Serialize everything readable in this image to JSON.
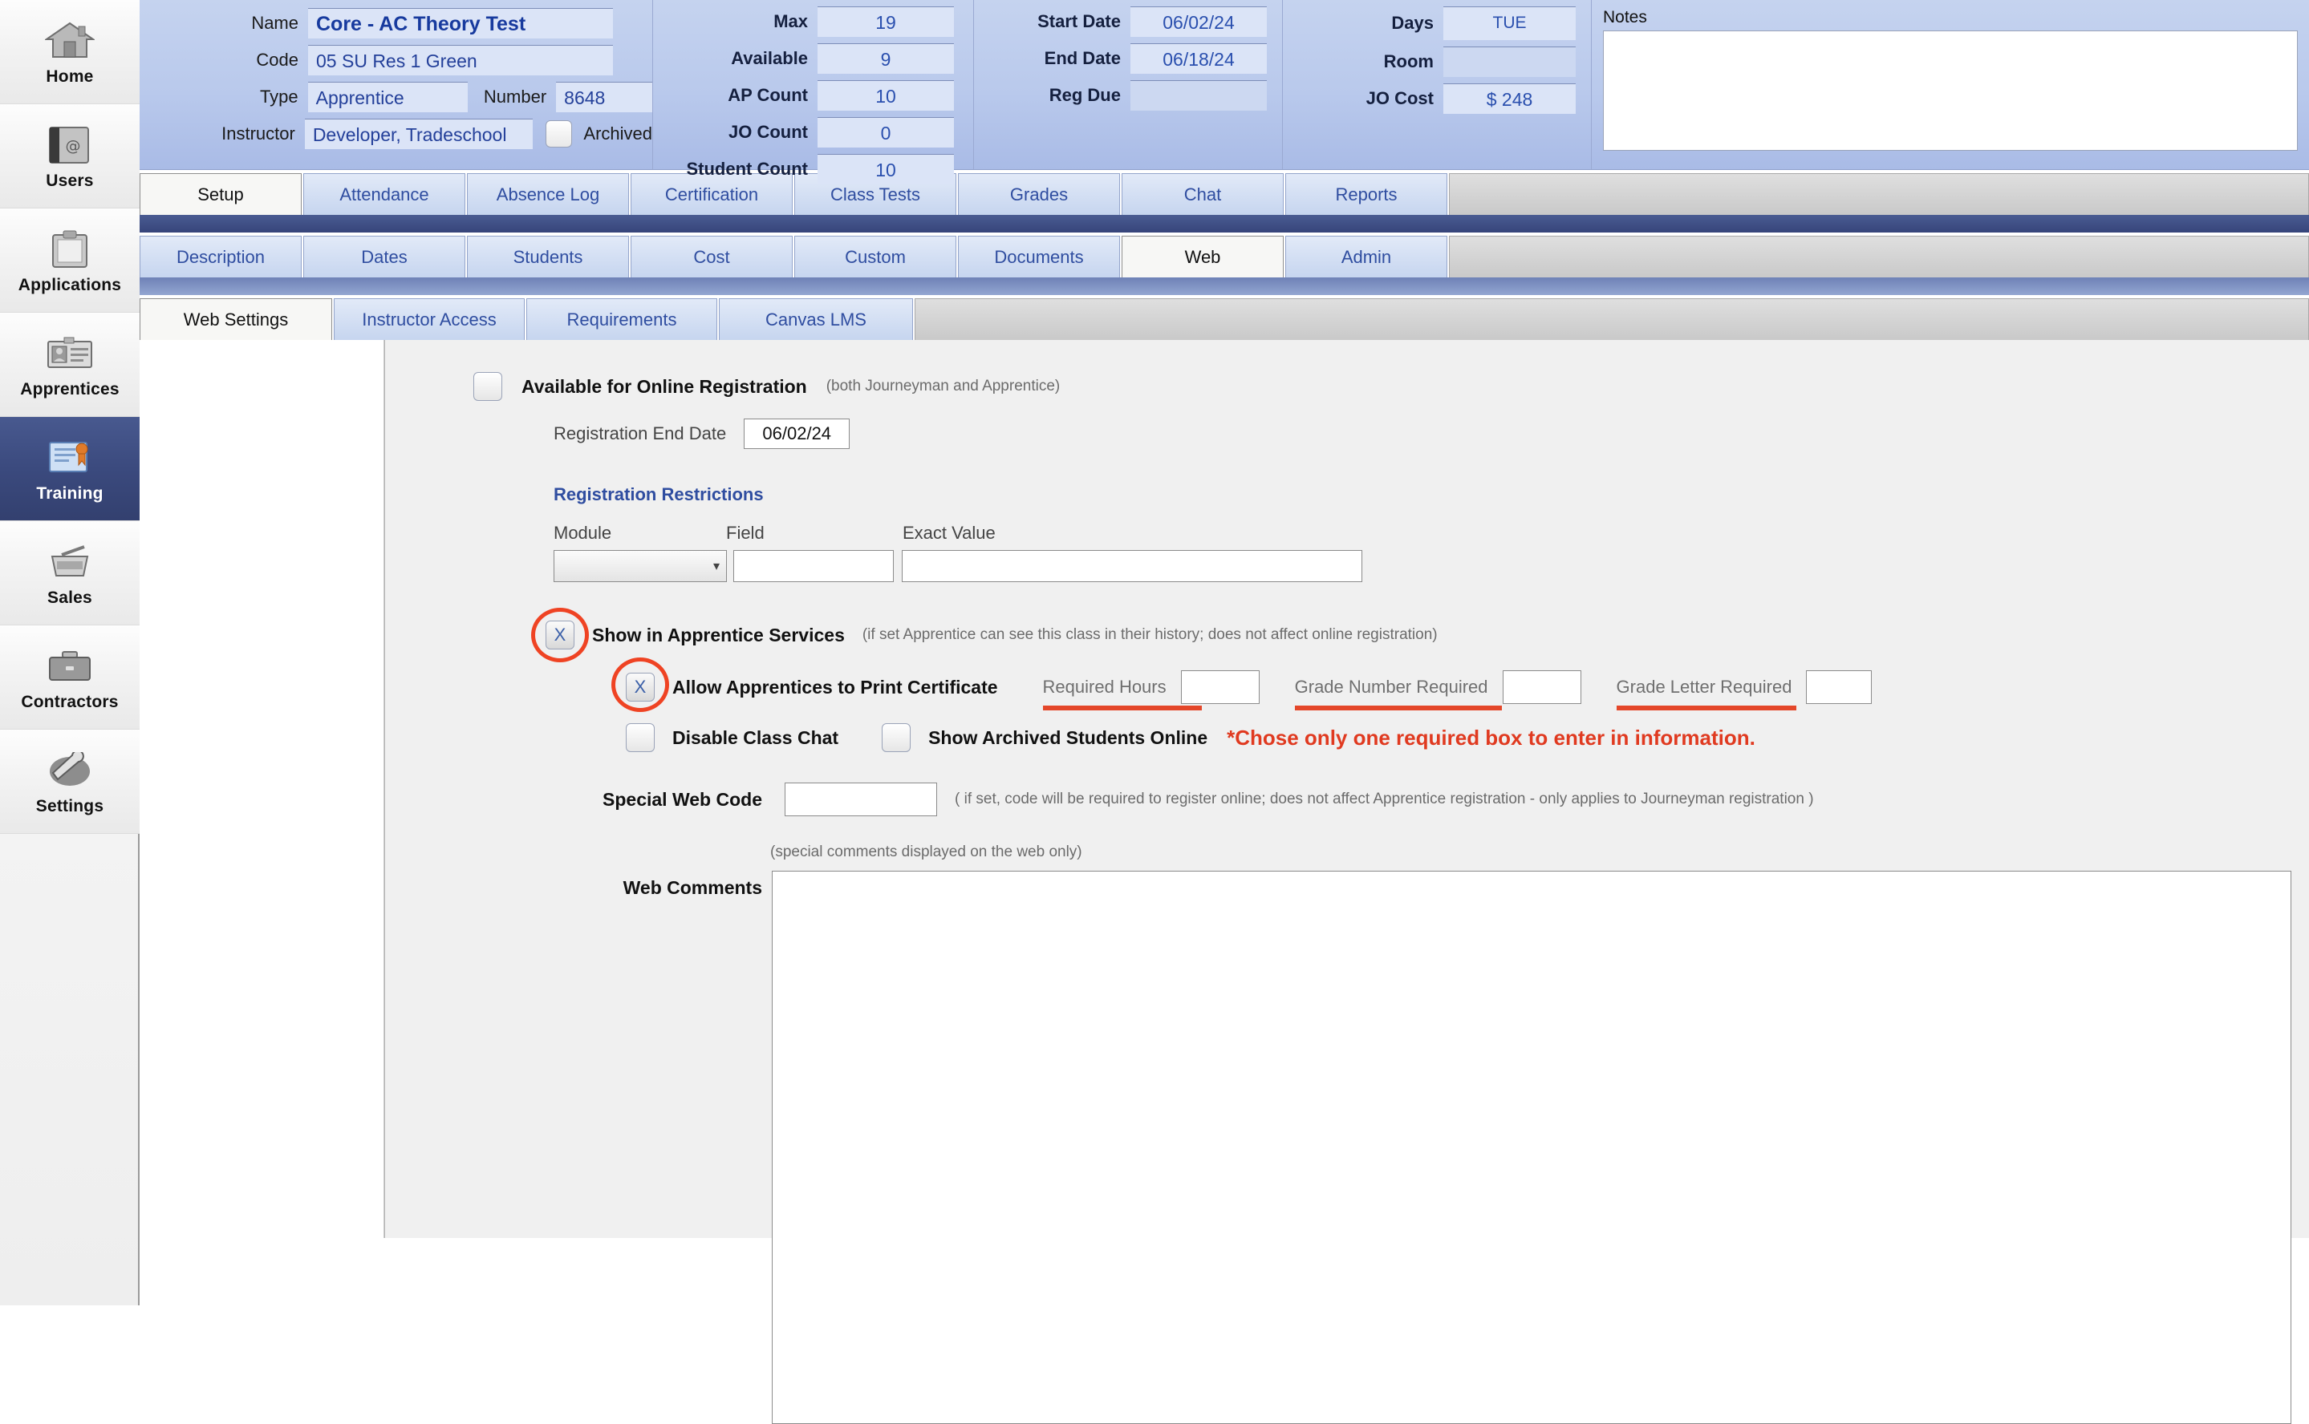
{
  "sidebar": {
    "items": [
      {
        "label": "Home",
        "icon": "house-icon",
        "active": false
      },
      {
        "label": "Users",
        "icon": "address-book-icon",
        "active": false
      },
      {
        "label": "Applications",
        "icon": "clipboard-icon",
        "active": false
      },
      {
        "label": "Apprentices",
        "icon": "id-card-icon",
        "active": false
      },
      {
        "label": "Training",
        "icon": "certificate-icon",
        "active": true
      },
      {
        "label": "Sales",
        "icon": "basket-icon",
        "active": false
      },
      {
        "label": "Contractors",
        "icon": "briefcase-icon",
        "active": false
      },
      {
        "label": "Settings",
        "icon": "wrench-icon",
        "active": false
      }
    ]
  },
  "header": {
    "name_label": "Name",
    "name_value": "Core - AC Theory Test",
    "code_label": "Code",
    "code_value": "05 SU Res 1  Green",
    "type_label": "Type",
    "type_value": "Apprentice",
    "number_label": "Number",
    "number_value": "8648",
    "instructor_label": "Instructor",
    "instructor_value": "Developer, Tradeschool",
    "archived_label": "Archived",
    "archived_checked": false,
    "counts": [
      {
        "label": "Max",
        "value": "19"
      },
      {
        "label": "Available",
        "value": "9"
      },
      {
        "label": "AP Count",
        "value": "10"
      },
      {
        "label": "JO Count",
        "value": "0"
      },
      {
        "label": "Student Count",
        "value": "10"
      }
    ],
    "dates": [
      {
        "label": "Start Date",
        "value": "06/02/24"
      },
      {
        "label": "End Date",
        "value": "06/18/24"
      },
      {
        "label": "Reg Due",
        "value": ""
      }
    ],
    "misc": [
      {
        "label": "Days",
        "value": "TUE"
      },
      {
        "label": "Room",
        "value": ""
      },
      {
        "label": "JO Cost",
        "value": "$ 248"
      }
    ],
    "notes_label": "Notes",
    "notes_value": ""
  },
  "tabs_primary": [
    {
      "label": "Setup",
      "active": true
    },
    {
      "label": "Attendance",
      "active": false
    },
    {
      "label": "Absence Log",
      "active": false
    },
    {
      "label": "Certification",
      "active": false
    },
    {
      "label": "Class Tests",
      "active": false
    },
    {
      "label": "Grades",
      "active": false
    },
    {
      "label": "Chat",
      "active": false
    },
    {
      "label": "Reports",
      "active": false
    }
  ],
  "tabs_secondary": [
    {
      "label": "Description",
      "active": false
    },
    {
      "label": "Dates",
      "active": false
    },
    {
      "label": "Students",
      "active": false
    },
    {
      "label": "Cost",
      "active": false
    },
    {
      "label": "Custom",
      "active": false
    },
    {
      "label": "Documents",
      "active": false
    },
    {
      "label": "Web",
      "active": true
    },
    {
      "label": "Admin",
      "active": false
    }
  ],
  "tabs_tertiary": [
    {
      "label": "Web Settings",
      "active": true
    },
    {
      "label": "Instructor Access",
      "active": false
    },
    {
      "label": "Requirements",
      "active": false
    },
    {
      "label": "Canvas LMS",
      "active": false
    }
  ],
  "form": {
    "available_online_label": "Available for Online Registration",
    "available_online_hint": "(both Journeyman and Apprentice)",
    "available_online_checked": false,
    "reg_end_date_label": "Registration End Date",
    "reg_end_date_value": "06/02/24",
    "restrictions_title": "Registration Restrictions",
    "restriction_columns": [
      "Module",
      "Field",
      "Exact Value"
    ],
    "restriction_module_value": "",
    "restriction_field_value": "",
    "restriction_exact_value": "",
    "show_apprentice_services_label": "Show in Apprentice Services",
    "show_apprentice_services_hint": "(if set Apprentice can see this class in their history; does not affect online registration)",
    "show_apprentice_services_mark": "X",
    "allow_print_cert_label": "Allow Apprentices to Print Certificate",
    "allow_print_cert_mark": "X",
    "required_hours_label": "Required Hours",
    "required_hours_value": "",
    "grade_number_label": "Grade Number Required",
    "grade_number_value": "",
    "grade_letter_label": "Grade Letter Required",
    "grade_letter_value": "",
    "disable_chat_label": "Disable Class Chat",
    "disable_chat_checked": false,
    "show_archived_label": "Show Archived Students Online",
    "show_archived_checked": false,
    "annotation_note": "*Chose only one required box to enter in information.",
    "special_web_code_label": "Special Web Code",
    "special_web_code_value": "",
    "special_web_code_hint": "( if set, code will be required to register online; does not affect Apprentice registration - only applies to Journeyman registration )",
    "web_comments_hint": "(special comments displayed on the web only)",
    "web_comments_label": "Web Comments",
    "web_comments_value": ""
  },
  "colors": {
    "accent_blue": "#2f4da0",
    "annotation_red": "#e4472a",
    "active_nav": "#3b4a7e",
    "header_blue": "#b9c9ec"
  }
}
